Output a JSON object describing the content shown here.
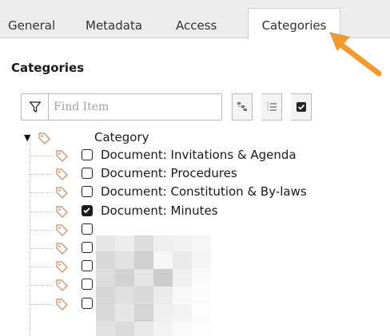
{
  "tabs": [
    {
      "label": "General"
    },
    {
      "label": "Metadata"
    },
    {
      "label": "Access"
    },
    {
      "label": "Categories"
    }
  ],
  "active_tab": "Categories",
  "section": {
    "title": "Categories"
  },
  "filter": {
    "placeholder": "Find Item",
    "value": ""
  },
  "tree": {
    "root": {
      "label": "Category",
      "expanded": true
    },
    "items": [
      {
        "label": "Document: Invitations & Agenda",
        "checked": false
      },
      {
        "label": "Document: Procedures",
        "checked": false
      },
      {
        "label": "Document: Constitution & By-laws",
        "checked": false
      },
      {
        "label": "Document: Minutes",
        "checked": true
      },
      {
        "label": "",
        "checked": false
      },
      {
        "label": "",
        "checked": false
      },
      {
        "label": "",
        "checked": false
      },
      {
        "label": "",
        "checked": false
      },
      {
        "label": "",
        "checked": false
      }
    ]
  },
  "colors": {
    "accent_arrow": "#f29a2e",
    "tag_icon": "#e9a16a",
    "tab_bar": "#ededed"
  },
  "icons": [
    "filter-icon",
    "tree-collapse-icon",
    "tree-list-icon",
    "check-all-icon",
    "tag-icon"
  ]
}
